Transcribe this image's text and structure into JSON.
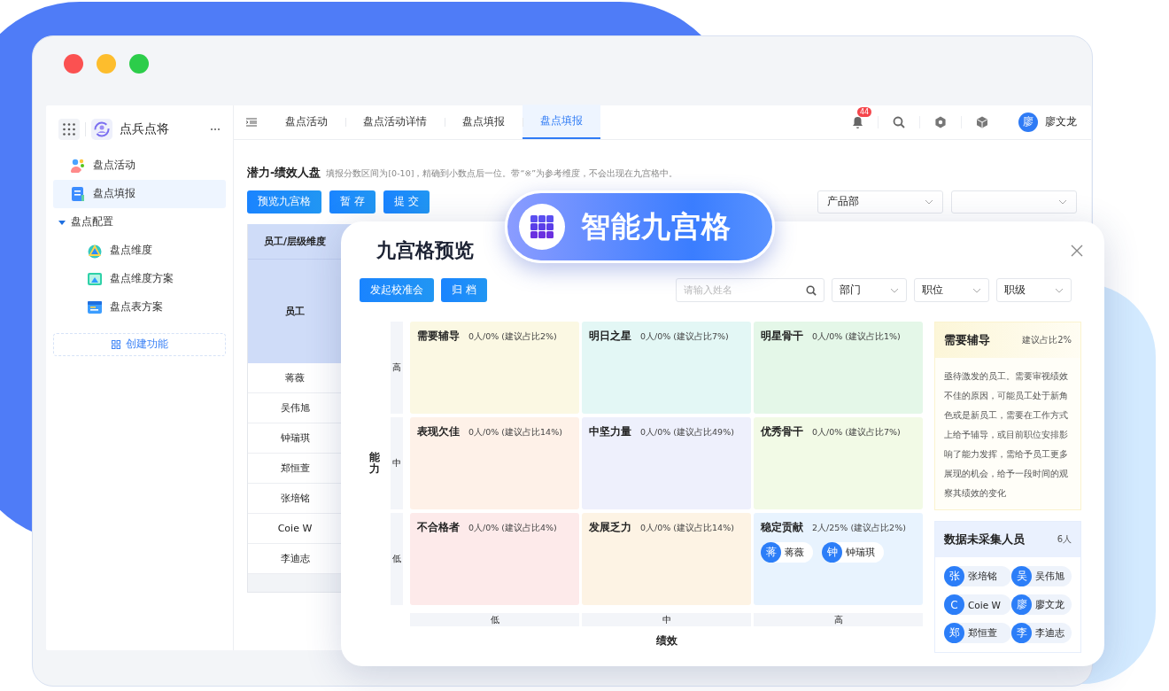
{
  "app": {
    "name": "点兵点将"
  },
  "sidebar": {
    "items": [
      {
        "label": "盘点活动",
        "selected": false
      },
      {
        "label": "盘点填报",
        "selected": true
      },
      {
        "label": "盘点配置",
        "selected": false,
        "expanded": true,
        "children": [
          {
            "label": "盘点维度",
            "selected": false
          },
          {
            "label": "盘点维度方案",
            "selected": false
          },
          {
            "label": "盘点表方案",
            "selected": false
          }
        ]
      }
    ],
    "create_button": "创建功能"
  },
  "tabs": [
    {
      "label": "盘点活动",
      "selected": false
    },
    {
      "label": "盘点活动详情",
      "selected": false
    },
    {
      "label": "盘点填报",
      "selected": false
    },
    {
      "label": "盘点填报",
      "selected": true
    }
  ],
  "header": {
    "notification_count": "44",
    "user": {
      "avatar": "廖",
      "name": "廖文龙"
    }
  },
  "page": {
    "title": "潜力-绩效人盘",
    "hint": "填报分数区间为[0-10]，精确到小数点后一位。带“※”为参考维度，不会出现在九宫格中。",
    "buttons": [
      "预览九宫格",
      "暂 存",
      "提 交"
    ],
    "filters": [
      {
        "kind": "select",
        "value": "产品部"
      },
      {
        "kind": "select"
      }
    ]
  },
  "table": {
    "columns": [
      "员工/层级维度"
    ],
    "group_header": "员工",
    "rows": [
      "蒋薇",
      "吴伟旭",
      "钟瑞琪",
      "郑恒萱",
      "张培铭",
      "Coie W",
      "李迪志"
    ]
  },
  "badge": {
    "label": "智能九宫格"
  },
  "modal": {
    "title": "九宫格预览",
    "buttons": [
      "发起校准会",
      "归 档"
    ],
    "search": {
      "placeholder": "请输入姓名"
    },
    "filters": [
      "部门",
      "职位",
      "职级"
    ],
    "y_axis": {
      "title": "能力",
      "labels": [
        "高",
        "中",
        "低"
      ]
    },
    "x_axis": {
      "title": "绩效",
      "labels": [
        "低",
        "中",
        "高"
      ]
    },
    "cells": [
      {
        "name": "需要辅导",
        "stats": "0人/0% (建议占比2%)",
        "color": "#fbf8e3"
      },
      {
        "name": "明日之星",
        "stats": "0人/0% (建议占比7%)",
        "color": "#e3f7f5"
      },
      {
        "name": "明星骨干",
        "stats": "0人/0% (建议占比1%)",
        "color": "#e4f7e8"
      },
      {
        "name": "表现欠佳",
        "stats": "0人/0% (建议占比14%)",
        "color": "#fef1e8"
      },
      {
        "name": "中坚力量",
        "stats": "0人/0% (建议占比49%)",
        "color": "#eef0fc"
      },
      {
        "name": "优秀骨干",
        "stats": "0人/0% (建议占比7%)",
        "color": "#f2fae6"
      },
      {
        "name": "不合格者",
        "stats": "0人/0% (建议占比4%)",
        "color": "#fdeaea"
      },
      {
        "name": "发展乏力",
        "stats": "0人/0% (建议占比14%)",
        "color": "#fdf3e4"
      },
      {
        "name": "稳定贡献",
        "stats": "2人/25% (建议占比2%)",
        "color": "#e8f3fe",
        "people": [
          {
            "avatar": "蒋",
            "name": "蒋薇"
          },
          {
            "avatar": "钟",
            "name": "钟瑞琪"
          }
        ]
      }
    ],
    "detail": {
      "title": "需要辅导",
      "ratio": "建议占比2%",
      "description": "亟待激发的员工。需要审视绩效不佳的原因，可能员工处于新角色或是新员工，需要在工作方式上给予辅导，或目前职位安排影响了能力发挥，需给予员工更多展现的机会，给予一段时间的观察其绩效的变化"
    },
    "uncollected": {
      "title": "数据未采集人员",
      "count": "6人",
      "people": [
        {
          "avatar": "张",
          "name": "张培铭"
        },
        {
          "avatar": "吴",
          "name": "吴伟旭"
        },
        {
          "avatar": "C",
          "name": "Coie W"
        },
        {
          "avatar": "廖",
          "name": "廖文龙"
        },
        {
          "avatar": "郑",
          "name": "郑恒萱"
        },
        {
          "avatar": "李",
          "name": "李迪志"
        }
      ]
    }
  }
}
